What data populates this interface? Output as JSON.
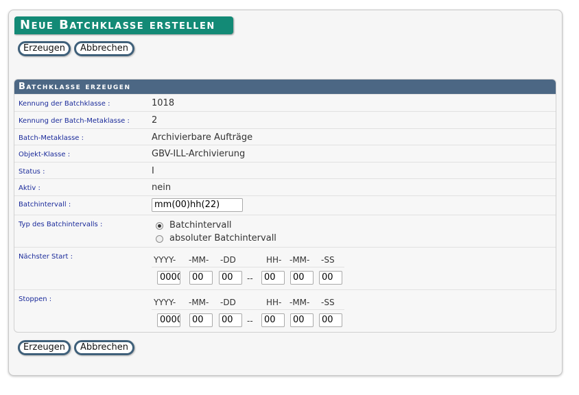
{
  "page": {
    "title": "Neue Batchklasse erstellen"
  },
  "buttons": {
    "create": "Erzeugen",
    "cancel": "Abbrechen"
  },
  "panel": {
    "header": "Batchklasse erzeugen",
    "fields": {
      "kennung_batchklasse": {
        "label": "Kennung der Batchklasse",
        "value": "1018"
      },
      "kennung_metaklasse": {
        "label": "Kennung der Batch-Metaklasse",
        "value": "2"
      },
      "metaklasse": {
        "label": "Batch-Metaklasse",
        "value": "Archivierbare Aufträge"
      },
      "objekt_klasse": {
        "label": "Objekt-Klasse",
        "value": "GBV-ILL-Archivierung"
      },
      "status": {
        "label": "Status",
        "value": "I"
      },
      "aktiv": {
        "label": "Aktiv",
        "value": "nein"
      },
      "batchintervall": {
        "label": "Batchintervall",
        "value": "mm(00)hh(22)"
      },
      "typ": {
        "label": "Typ des Batchintervalls",
        "options": [
          "Batchintervall",
          "absoluter Batchintervall"
        ],
        "selected": "Batchintervall"
      },
      "naechster_start": {
        "label": "Nächster Start",
        "year": "0000",
        "month": "00",
        "day": "00",
        "hour": "00",
        "minute": "00",
        "second": "00"
      },
      "stoppen": {
        "label": "Stoppen",
        "year": "0000",
        "month": "00",
        "day": "00",
        "hour": "00",
        "minute": "00",
        "second": "00"
      }
    },
    "separator": ":",
    "datetime_headers": {
      "year": "YYYY-",
      "month": "-MM-",
      "day": "-DD",
      "hour": "HH-",
      "minute": "-MM-",
      "second": "-SS",
      "dash": "--"
    }
  }
}
